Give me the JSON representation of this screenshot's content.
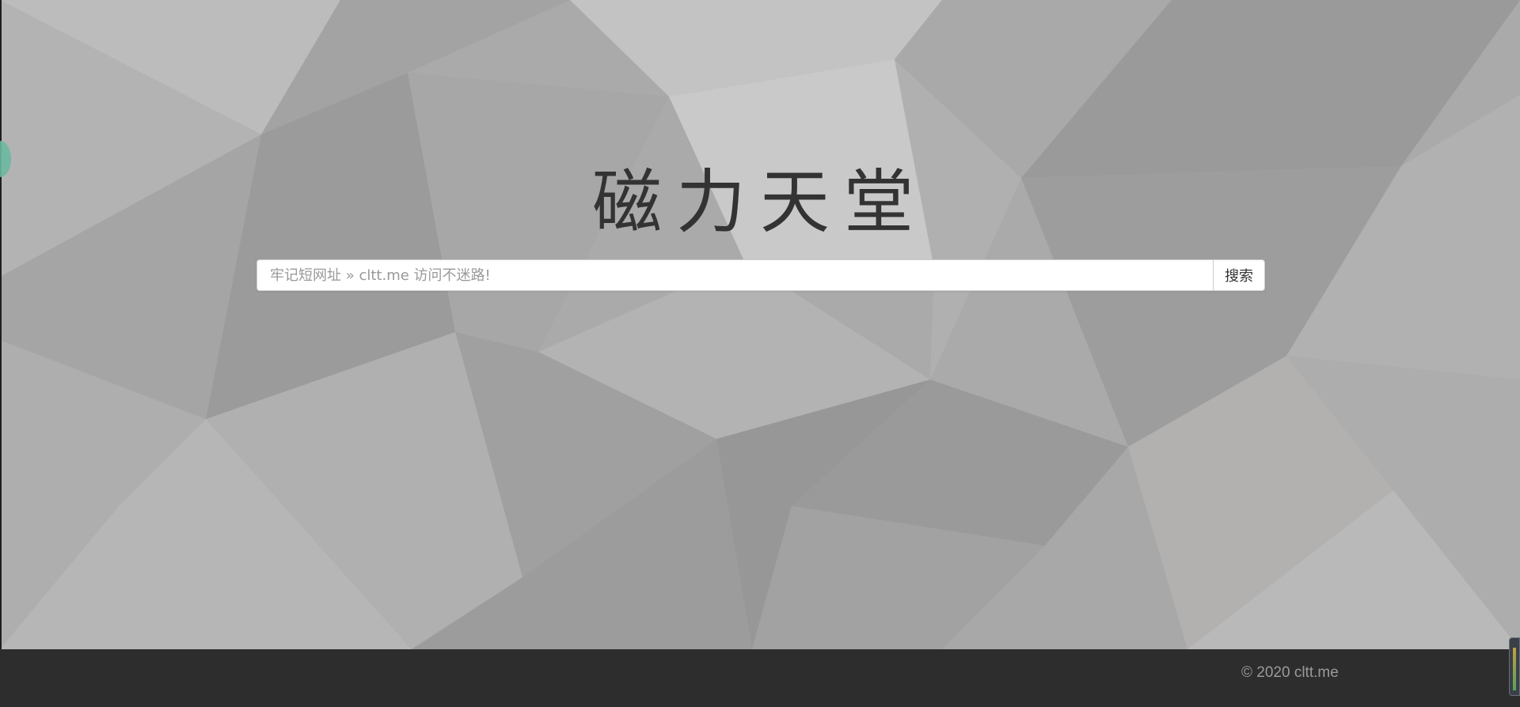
{
  "site": {
    "title": "磁力天堂"
  },
  "search": {
    "placeholder": "牢记短网址 » cltt.me 访问不迷路!",
    "value": "",
    "button_label": "搜索"
  },
  "footer": {
    "copyright": "© 2020 cltt.me"
  },
  "colors": {
    "title_text": "#333333",
    "footer_background": "#2d2d2d",
    "footer_text": "#9a9a9a",
    "input_border": "#cccccc",
    "side_tab_accent": "#6bb8a0"
  },
  "icons": {
    "side_tab": "side-tab-handle-icon",
    "widget": "floating-widget-icon"
  }
}
